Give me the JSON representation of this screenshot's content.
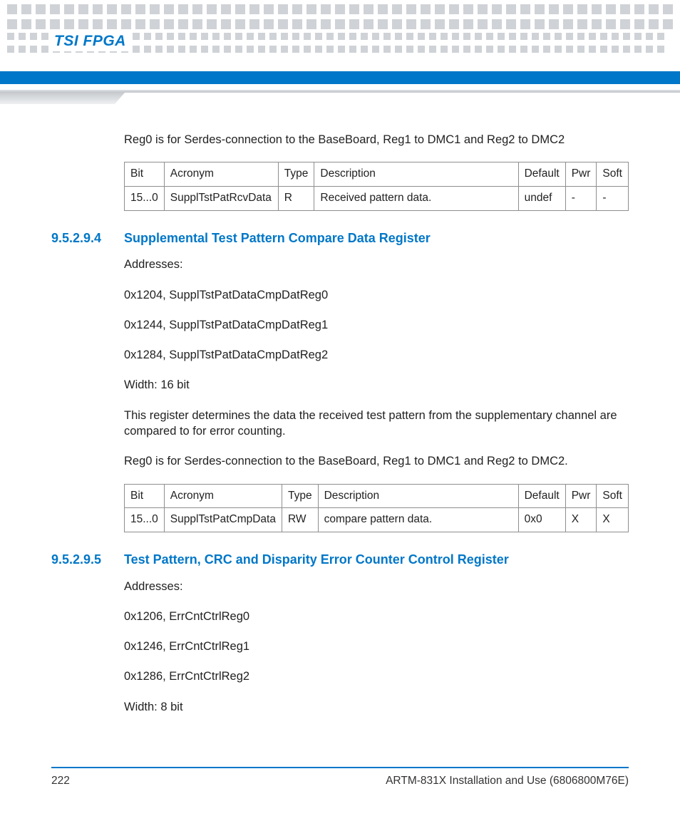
{
  "header": {
    "title": "TSI FPGA"
  },
  "intro_para": "Reg0 is for Serdes-connection to the BaseBoard, Reg1 to DMC1 and Reg2 to DMC2",
  "table_headers": {
    "bit": "Bit",
    "acronym": "Acronym",
    "type": "Type",
    "description": "Description",
    "default": "Default",
    "pwr": "Pwr",
    "soft": "Soft"
  },
  "table1": {
    "row": {
      "bit": "15...0",
      "acronym": "SupplTstPatRcvData",
      "type": "R",
      "description": "Received pattern data.",
      "default": "undef",
      "pwr": "-",
      "soft": "-"
    }
  },
  "section1": {
    "num": "9.5.2.9.4",
    "title": "Supplemental Test Pattern Compare Data Register",
    "addresses_label": "Addresses:",
    "addr0": "0x1204, SupplTstPatDataCmpDatReg0",
    "addr1": "0x1244, SupplTstPatDataCmpDatReg1",
    "addr2": "0x1284, SupplTstPatDataCmpDatReg2",
    "width": "Width: 16 bit",
    "desc": "This register determines the data the received test pattern from the supplementary channel are compared to for error counting.",
    "reg_note": "Reg0 is for Serdes-connection to the BaseBoard, Reg1 to DMC1 and Reg2 to DMC2."
  },
  "table2": {
    "row": {
      "bit": "15...0",
      "acronym": "SupplTstPatCmpData",
      "type": "RW",
      "description": "compare pattern data.",
      "default": "0x0",
      "pwr": "X",
      "soft": "X"
    }
  },
  "section2": {
    "num": "9.5.2.9.5",
    "title": "Test Pattern, CRC and Disparity Error Counter Control Register",
    "addresses_label": "Addresses:",
    "addr0": "0x1206, ErrCntCtrlReg0",
    "addr1": "0x1246, ErrCntCtrlReg1",
    "addr2": "0x1286, ErrCntCtrlReg2",
    "width": "Width: 8 bit"
  },
  "footer": {
    "page": "222",
    "doc": "ARTM-831X Installation and Use (6806800M76E)"
  }
}
